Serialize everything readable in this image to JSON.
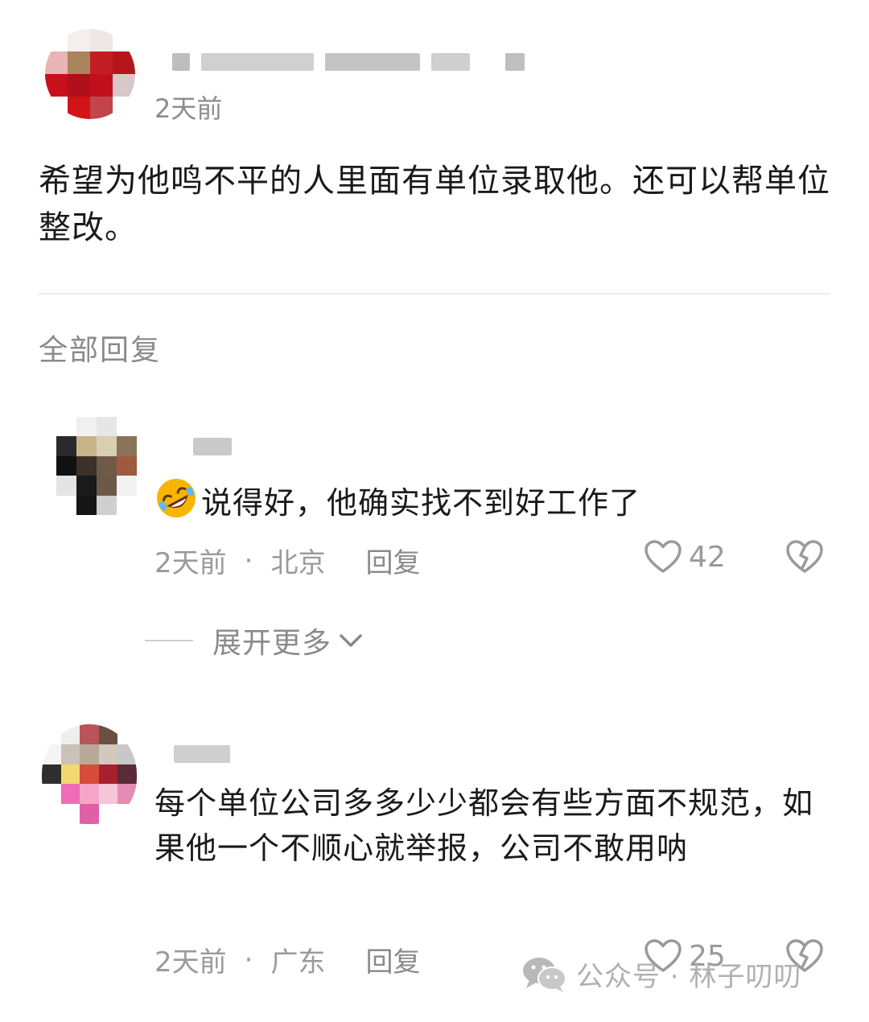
{
  "main_comment": {
    "time": "2天前",
    "text": "希望为他鸣不平的人里面有单位录取他。还可以帮单位整改。"
  },
  "replies_section": {
    "title": "全部回复"
  },
  "replies": [
    {
      "text": "说得好，他确实找不到好工作了",
      "emoji": "rolling-on-floor-laughing",
      "time": "2天前",
      "separator": "·",
      "location": "北京",
      "reply_label": "回复",
      "likes": "42"
    },
    {
      "text": "每个单位公司多多少少都会有些方面不规范，如果他一个不顺心就举报，公司不敢用呐",
      "time": "2天前",
      "separator": "·",
      "location": "广东",
      "reply_label": "回复",
      "likes": "25"
    }
  ],
  "expand": {
    "label": "展开更多"
  },
  "watermark": {
    "text": "公众号 · 林子叨叨"
  },
  "icons": {
    "like": "heart-outline-icon",
    "dislike": "broken-heart-icon",
    "expand": "chevron-down-icon",
    "watermark": "wechat-icon"
  },
  "colors": {
    "text_primary": "#1a1a1a",
    "text_secondary": "#9a9a9a",
    "divider": "#ececec",
    "emoji_yellow": "#f7b500"
  }
}
